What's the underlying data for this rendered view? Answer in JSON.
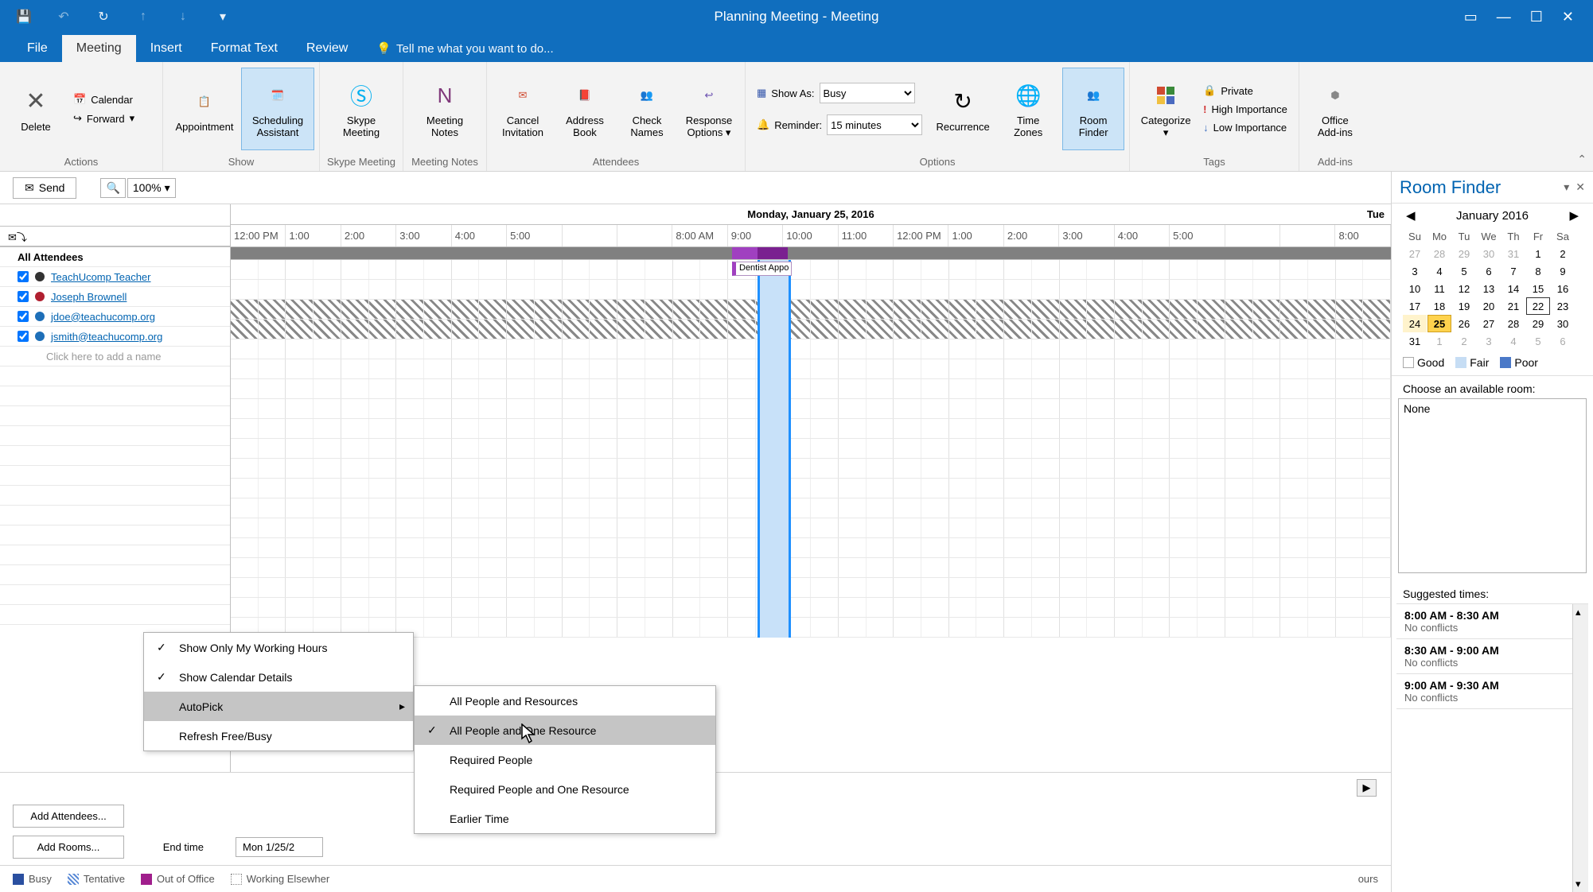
{
  "title": "Planning Meeting - Meeting",
  "tabs": {
    "file": "File",
    "meeting": "Meeting",
    "insert": "Insert",
    "format": "Format Text",
    "review": "Review",
    "tellme": "Tell me what you want to do..."
  },
  "ribbon": {
    "actions": {
      "delete": "Delete",
      "calendar": "Calendar",
      "forward": "Forward",
      "label": "Actions"
    },
    "show": {
      "appointment": "Appointment",
      "scheduling": "Scheduling\nAssistant",
      "label": "Show"
    },
    "skype": {
      "btn": "Skype\nMeeting",
      "label": "Skype Meeting"
    },
    "notes": {
      "btn": "Meeting\nNotes",
      "label": "Meeting Notes"
    },
    "attendees": {
      "cancel": "Cancel\nInvitation",
      "address": "Address\nBook",
      "check": "Check\nNames",
      "response": "Response\nOptions ▾",
      "label": "Attendees"
    },
    "options": {
      "showas_lbl": "Show As:",
      "showas_val": "Busy",
      "reminder_lbl": "Reminder:",
      "reminder_val": "15 minutes",
      "recurrence": "Recurrence",
      "timezones": "Time\nZones",
      "roomfinder": "Room\nFinder",
      "label": "Options"
    },
    "tags": {
      "categorize": "Categorize\n▾",
      "private": "Private",
      "high": "High Importance",
      "low": "Low Importance",
      "label": "Tags"
    },
    "addins": {
      "btn": "Office\nAdd-ins",
      "label": "Add-ins"
    }
  },
  "send": {
    "btn": "Send",
    "zoom": "100%"
  },
  "schedule": {
    "day_header": "Monday, January 25, 2016",
    "next_day_short": "Tue",
    "hours": [
      "12:00 PM",
      "1:00",
      "2:00",
      "3:00",
      "4:00",
      "5:00",
      " ",
      " ",
      "8:00 AM",
      "9:00",
      "10:00",
      "11:00",
      "12:00 PM",
      "1:00",
      "2:00",
      "3:00",
      "4:00",
      "5:00",
      " ",
      " ",
      "8:00"
    ],
    "all_label": "All Attendees",
    "attendees": [
      {
        "name": "TeachUcomp Teacher",
        "dot": "#333333"
      },
      {
        "name": "Joseph Brownell",
        "dot": "#b02030"
      },
      {
        "name": "jdoe@teachucomp.org",
        "dot": "#1e6fb8"
      },
      {
        "name": "jsmith@teachucomp.org",
        "dot": "#1e6fb8"
      }
    ],
    "add_name_placeholder": "Click here to add a name",
    "appt_label": "Dentist Appo"
  },
  "footer": {
    "add_attendees": "Add Attendees...",
    "add_rooms": "Add Rooms...",
    "end_label": "End time",
    "end_val": "Mon 1/25/2"
  },
  "legend": {
    "busy": "Busy",
    "tentative": "Tentative",
    "oof": "Out of Office",
    "elsewhere": "Working Elsewher",
    "tail": "ours"
  },
  "context_menu": {
    "items": [
      "Show Only My Working Hours",
      "Show Calendar Details",
      "AutoPick",
      "Refresh Free/Busy"
    ]
  },
  "submenu": {
    "items": [
      "All People and Resources",
      "All People and One Resource",
      "Required People",
      "Required People and One Resource",
      "Earlier Time"
    ]
  },
  "room_finder": {
    "title": "Room Finder",
    "month": "January 2016",
    "dow": [
      "Su",
      "Mo",
      "Tu",
      "We",
      "Th",
      "Fr",
      "Sa"
    ],
    "weeks": [
      [
        27,
        28,
        29,
        30,
        31,
        1,
        2
      ],
      [
        3,
        4,
        5,
        6,
        7,
        8,
        9
      ],
      [
        10,
        11,
        12,
        13,
        14,
        15,
        16
      ],
      [
        17,
        18,
        19,
        20,
        21,
        22,
        23
      ],
      [
        24,
        25,
        26,
        27,
        28,
        29,
        30
      ],
      [
        31,
        1,
        2,
        3,
        4,
        5,
        6
      ]
    ],
    "key": {
      "good": "Good",
      "fair": "Fair",
      "poor": "Poor"
    },
    "choose": "Choose an available room:",
    "room_none": "None",
    "suggested": "Suggested times:",
    "suggestions": [
      {
        "time": "8:00 AM - 8:30 AM",
        "sub": "No conflicts"
      },
      {
        "time": "8:30 AM - 9:00 AM",
        "sub": "No conflicts"
      },
      {
        "time": "9:00 AM - 9:30 AM",
        "sub": "No conflicts"
      }
    ]
  },
  "colors": {
    "meeting_busy_purple": "#a040c0",
    "busy_blue": "#2a4fa0",
    "oof_magenta": "#a01e8c",
    "fair_blue": "#c6ddf4",
    "poor_blue": "#4a79c8"
  }
}
